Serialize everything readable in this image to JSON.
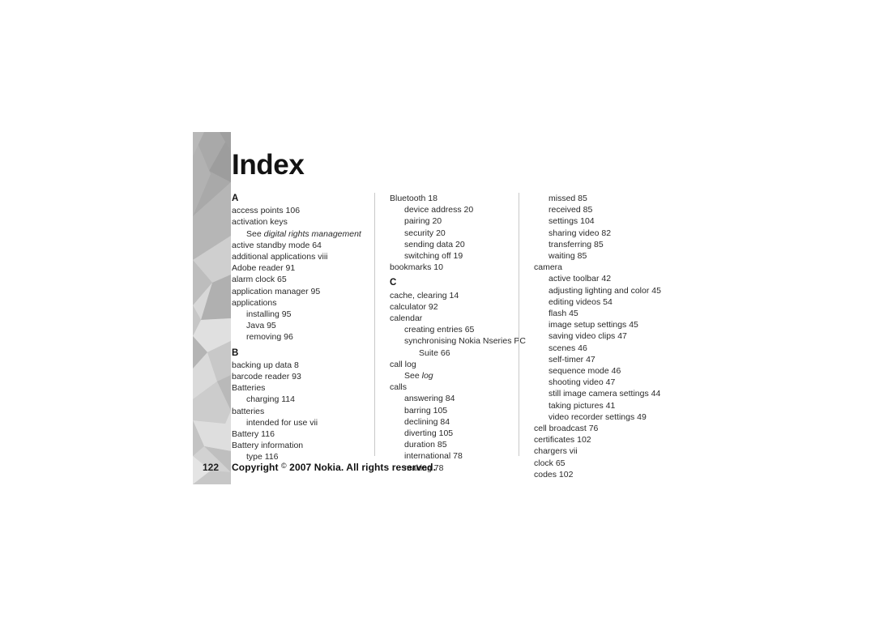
{
  "document": {
    "title": "Index",
    "page_number": "122",
    "copyright": {
      "prefix": "Copyright",
      "symbol": "©",
      "suffix": "2007 Nokia. All rights reserved."
    }
  },
  "graphic": {
    "name": "faceted-grayscale-band",
    "colors": [
      "#9a9a9a",
      "#a8a8a8",
      "#b5b5b5",
      "#c2c2c2",
      "#cfcfcf",
      "#dcdcdc",
      "#e8e8e8",
      "#8f8f8f"
    ]
  },
  "columns": [
    {
      "id": "column-1",
      "blocks": [
        {
          "type": "letter",
          "label": "A"
        },
        {
          "type": "entry",
          "level": 0,
          "text": "access points 106"
        },
        {
          "type": "entry",
          "level": 0,
          "text": "activation keys"
        },
        {
          "type": "entry",
          "level": 1,
          "text": "See digital rights management",
          "see_prefix": "See",
          "see_target": "digital rights management"
        },
        {
          "type": "entry",
          "level": 0,
          "text": "active standby mode 64"
        },
        {
          "type": "entry",
          "level": 0,
          "text": "additional applications viii"
        },
        {
          "type": "entry",
          "level": 0,
          "text": "Adobe reader 91"
        },
        {
          "type": "entry",
          "level": 0,
          "text": "alarm clock 65"
        },
        {
          "type": "entry",
          "level": 0,
          "text": "application manager 95"
        },
        {
          "type": "entry",
          "level": 0,
          "text": "applications"
        },
        {
          "type": "entry",
          "level": 1,
          "text": "installing 95"
        },
        {
          "type": "entry",
          "level": 1,
          "text": "Java 95"
        },
        {
          "type": "entry",
          "level": 1,
          "text": "removing 96"
        },
        {
          "type": "letter",
          "label": "B"
        },
        {
          "type": "entry",
          "level": 0,
          "text": "backing up data 8"
        },
        {
          "type": "entry",
          "level": 0,
          "text": "barcode reader 93"
        },
        {
          "type": "entry",
          "level": 0,
          "text": "Batteries"
        },
        {
          "type": "entry",
          "level": 1,
          "text": "charging 114"
        },
        {
          "type": "entry",
          "level": 0,
          "text": "batteries"
        },
        {
          "type": "entry",
          "level": 1,
          "text": "intended for use vii"
        },
        {
          "type": "entry",
          "level": 0,
          "text": "Battery 116"
        },
        {
          "type": "entry",
          "level": 0,
          "text": "Battery information"
        },
        {
          "type": "entry",
          "level": 1,
          "text": "type 116"
        }
      ]
    },
    {
      "id": "column-2",
      "blocks": [
        {
          "type": "entry",
          "level": 0,
          "text": "Bluetooth 18"
        },
        {
          "type": "entry",
          "level": 1,
          "text": "device address 20"
        },
        {
          "type": "entry",
          "level": 1,
          "text": "pairing 20"
        },
        {
          "type": "entry",
          "level": 1,
          "text": "security 20"
        },
        {
          "type": "entry",
          "level": 1,
          "text": "sending data 20"
        },
        {
          "type": "entry",
          "level": 1,
          "text": "switching off 19"
        },
        {
          "type": "entry",
          "level": 0,
          "text": "bookmarks 10"
        },
        {
          "type": "letter",
          "label": "C"
        },
        {
          "type": "entry",
          "level": 0,
          "text": "cache, clearing 14"
        },
        {
          "type": "entry",
          "level": 0,
          "text": "calculator 92"
        },
        {
          "type": "entry",
          "level": 0,
          "text": "calendar"
        },
        {
          "type": "entry",
          "level": 1,
          "text": "creating entries 65"
        },
        {
          "type": "entry",
          "level": 1,
          "text": "synchronising Nokia Nseries PC"
        },
        {
          "type": "entry",
          "level": 2,
          "text": "Suite 66"
        },
        {
          "type": "entry",
          "level": 0,
          "text": "call log"
        },
        {
          "type": "entry",
          "level": 1,
          "text": "See log",
          "see_prefix": "See",
          "see_target": "log"
        },
        {
          "type": "entry",
          "level": 0,
          "text": "calls"
        },
        {
          "type": "entry",
          "level": 1,
          "text": "answering 84"
        },
        {
          "type": "entry",
          "level": 1,
          "text": "barring 105"
        },
        {
          "type": "entry",
          "level": 1,
          "text": "declining 84"
        },
        {
          "type": "entry",
          "level": 1,
          "text": "diverting 105"
        },
        {
          "type": "entry",
          "level": 1,
          "text": "duration 85"
        },
        {
          "type": "entry",
          "level": 1,
          "text": "international 78"
        },
        {
          "type": "entry",
          "level": 1,
          "text": "making 78"
        }
      ]
    },
    {
      "id": "column-3",
      "blocks": [
        {
          "type": "entry",
          "level": 1,
          "text": "missed 85"
        },
        {
          "type": "entry",
          "level": 1,
          "text": "received 85"
        },
        {
          "type": "entry",
          "level": 1,
          "text": "settings 104"
        },
        {
          "type": "entry",
          "level": 1,
          "text": "sharing video 82"
        },
        {
          "type": "entry",
          "level": 1,
          "text": "transferring 85"
        },
        {
          "type": "entry",
          "level": 1,
          "text": "waiting 85"
        },
        {
          "type": "entry",
          "level": 0,
          "text": "camera"
        },
        {
          "type": "entry",
          "level": 1,
          "text": "active toolbar 42"
        },
        {
          "type": "entry",
          "level": 1,
          "text": "adjusting lighting and color 45"
        },
        {
          "type": "entry",
          "level": 1,
          "text": "editing videos 54"
        },
        {
          "type": "entry",
          "level": 1,
          "text": "flash 45"
        },
        {
          "type": "entry",
          "level": 1,
          "text": "image setup settings 45"
        },
        {
          "type": "entry",
          "level": 1,
          "text": "saving video clips 47"
        },
        {
          "type": "entry",
          "level": 1,
          "text": "scenes 46"
        },
        {
          "type": "entry",
          "level": 1,
          "text": "self-timer 47"
        },
        {
          "type": "entry",
          "level": 1,
          "text": "sequence mode 46"
        },
        {
          "type": "entry",
          "level": 1,
          "text": "shooting video 47"
        },
        {
          "type": "entry",
          "level": 1,
          "text": "still image camera settings 44"
        },
        {
          "type": "entry",
          "level": 1,
          "text": "taking pictures 41"
        },
        {
          "type": "entry",
          "level": 1,
          "text": "video recorder settings 49"
        },
        {
          "type": "entry",
          "level": 0,
          "text": "cell broadcast 76"
        },
        {
          "type": "entry",
          "level": 0,
          "text": "certificates 102"
        },
        {
          "type": "entry",
          "level": 0,
          "text": "chargers vii"
        },
        {
          "type": "entry",
          "level": 0,
          "text": "clock 65"
        },
        {
          "type": "entry",
          "level": 0,
          "text": "codes 102"
        }
      ]
    }
  ]
}
